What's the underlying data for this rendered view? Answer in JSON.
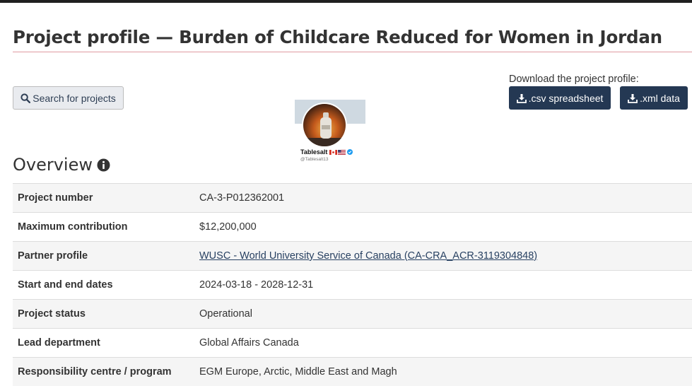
{
  "title": "Project profile — Burden of Childcare Reduced for Women in Jordan",
  "search_button": "Search for projects",
  "download": {
    "label": "Download the project profile:",
    "csv": ".csv spreadsheet",
    "xml": ".xml data"
  },
  "profile": {
    "name": "Tablesalt",
    "handle": "@Tablesalt13"
  },
  "overview": {
    "heading": "Overview",
    "rows": [
      {
        "label": "Project number",
        "value": "CA-3-P012362001"
      },
      {
        "label": "Maximum contribution",
        "value": "$12,200,000"
      },
      {
        "label": "Partner profile",
        "value": "WUSC - World University Service of Canada (CA-CRA_ACR-3119304848)"
      },
      {
        "label": "Start and end dates",
        "value": "2024-03-18 - 2028-12-31"
      },
      {
        "label": "Project status",
        "value": "Operational"
      },
      {
        "label": "Lead department",
        "value": "Global Affairs Canada"
      },
      {
        "label": "Responsibility centre / program",
        "value": "EGM Europe, Arctic, Middle East and Magh"
      }
    ]
  },
  "colors": {
    "primary_button": "#243853",
    "link": "#284162",
    "title_rule": "#e09aa0"
  }
}
